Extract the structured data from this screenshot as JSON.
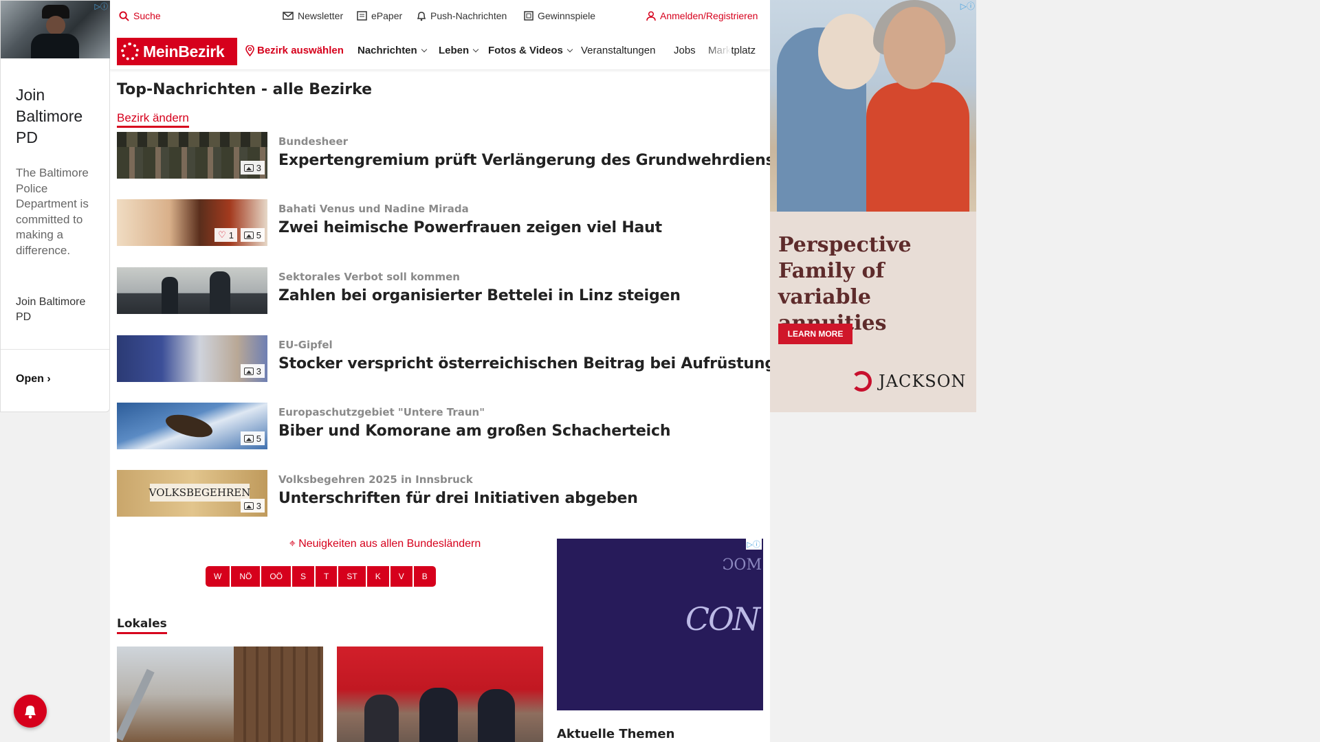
{
  "left_ad": {
    "headline": "Join Baltimore PD",
    "description": "The Baltimore Police Department is committed to making a difference.",
    "cta_text": "Join Baltimore PD",
    "open_label": "Open"
  },
  "topbar": {
    "search": "Suche",
    "newsletter": "Newsletter",
    "epaper": "ePaper",
    "push": "Push-Nachrichten",
    "games": "Gewinnspiele",
    "login": "Anmelden/Registrieren"
  },
  "navbar": {
    "logo": "MeinBezirk",
    "select_district": "Bezirk auswählen",
    "items": [
      "Nachrichten",
      "Leben",
      "Fotos & Videos",
      "Veranstaltungen",
      "Jobs",
      "Marktplatz"
    ]
  },
  "main": {
    "title": "Top-Nachrichten - alle Bezirke",
    "change_district": "Bezirk ändern",
    "articles": [
      {
        "kicker": "Bundesheer",
        "headline": "Expertengremium prüft Verlängerung des Grundwehrdienstes",
        "images": "3"
      },
      {
        "kicker": "Bahati Venus und Nadine Mirada",
        "headline": "Zwei heimische Powerfrauen zeigen viel Haut",
        "likes": "1",
        "images": "5"
      },
      {
        "kicker": "Sektorales Verbot soll kommen",
        "headline": "Zahlen bei organisierter Bettelei in Linz steigen"
      },
      {
        "kicker": "EU-Gipfel",
        "headline": "Stocker verspricht österreichischen Beitrag bei Aufrüstung",
        "images": "3"
      },
      {
        "kicker": "Europaschutzgebiet \"Untere Traun\"",
        "headline": "Biber und Komorane am großen Schacherteich",
        "images": "5"
      },
      {
        "kicker": "Volksbegehren 2025 in Innsbruck",
        "headline": "Unterschriften für drei Initiativen abgeben",
        "images": "3",
        "thumb_text": "VOLKSBEGEHREN"
      }
    ],
    "regions_label": "Neuigkeiten aus allen Bundesländern",
    "regions": [
      "W",
      "NÖ",
      "OÖ",
      "S",
      "T",
      "ST",
      "K",
      "V",
      "B"
    ],
    "local_title": "Lokales",
    "topics_title": "Aktuelle Themen"
  },
  "right_ad": {
    "headline": "Perspective Family of variable annuities",
    "cta": "LEARN MORE",
    "brand": "JACKSON"
  },
  "colors": {
    "brand_red": "#d6001c",
    "ad_purple": "#271b5a"
  }
}
